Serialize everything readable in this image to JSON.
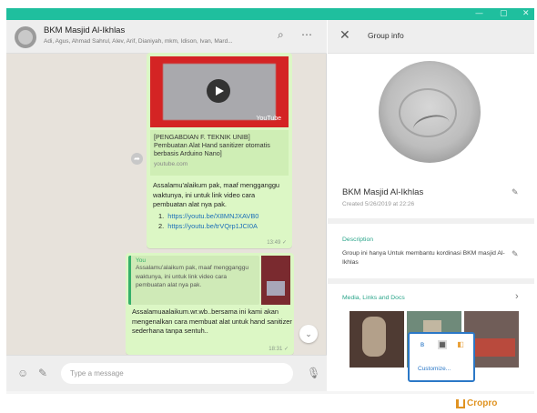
{
  "window": {
    "controls": [
      "—",
      "▢",
      "✕"
    ],
    "accent": "#1fbf9e"
  },
  "chat": {
    "header": {
      "name": "BKM Masjid Al-Ikhlas",
      "members": "Adi, Agus, Ahmad Sahrul, Alev, Arif, Dianiyah, mkm, Idison, Ivan, Mard..."
    },
    "message1": {
      "video_badge": "YouTube",
      "preview_title": "[PENGABDIAN F. TEKNIK UNIB] Pembuatan Alat Hand sanitizer otomatis berbasis Arduino Nano]",
      "preview_domain": "youtube.com",
      "text": "Assalamu'alaikum pak, maaf mengganggu waktunya, ini untuk link video cara pembuatan alat nya pak.",
      "link1_prefix": "1.",
      "link1": "https://youtu.be/X8MNJXAVB0",
      "link2_prefix": "2.",
      "link2": "https://youtu.be/trVQrp1JCI0A",
      "time": "13:49 ✓"
    },
    "message2": {
      "quote_author": "You",
      "quote_text": "Assalamu'alaikum pak, maaf mengganggu waktunya, ini untuk link video cara pembuatan alat nya pak.",
      "text": "Assalamuaalaikum.wr.wb..bersama ini kami akan mengenalkan cara membuat alat untuk hand sanitizer sederhana tanpa sentuh..",
      "time": "18:31 ✓"
    },
    "composer": {
      "placeholder": "Type a message"
    }
  },
  "group_info": {
    "title": "Group info",
    "name": "BKM Masjid Al-Ikhlas",
    "created": "Created 5/26/2019 at 22:26",
    "description_label": "Description",
    "description": "Group ini hanya Untuk membantu kordinasi BKM masjid Al-Ikhlas",
    "media_label": "Media, Links and Docs"
  },
  "popup": {
    "customize_label": "Customize..."
  },
  "watermark": {
    "label": "Cropro",
    "color": "#e09321"
  }
}
